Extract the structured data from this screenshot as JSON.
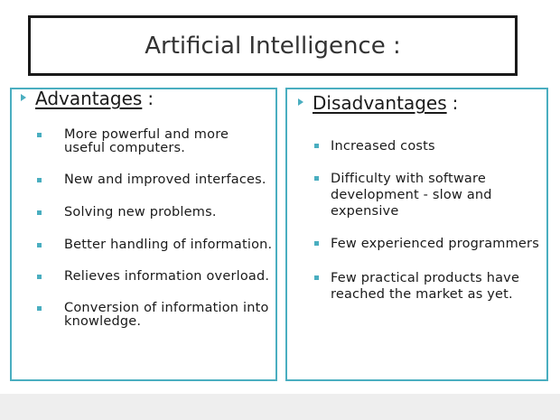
{
  "title": "Artificial Intelligence :",
  "advantages": {
    "heading": "Advantages",
    "colon": ":",
    "items": [
      "More powerful and more useful computers.",
      "New and improved interfaces.",
      "Solving new problems.",
      "Better handling of information.",
      "Relieves information overload.",
      "Conversion of information into knowledge."
    ]
  },
  "disadvantages": {
    "heading": "Disadvantages",
    "colon": ":",
    "items": [
      "Increased costs",
      "Difficulty with software development - slow and expensive",
      "Few experienced programmers",
      "Few practical products have reached the market as yet."
    ]
  },
  "colors": {
    "accent": "#4aaec0",
    "title_border": "#1a1a1a",
    "text": "#1a1a1a",
    "footer_band": "#eeeeee"
  }
}
